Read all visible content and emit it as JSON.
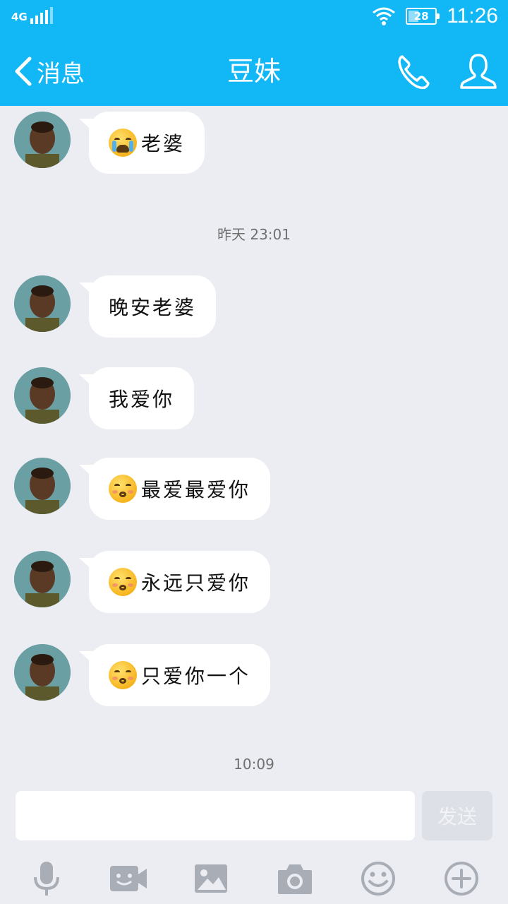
{
  "status_bar": {
    "network": "4G",
    "battery": "28",
    "time": "11:26"
  },
  "header": {
    "back_label": "消息",
    "title": "豆妹",
    "icons": [
      "phone-icon",
      "contact-icon"
    ]
  },
  "messages": [
    {
      "emoji": "crying-emoji",
      "text": "老婆"
    },
    {
      "emoji": null,
      "text": "晚安老婆"
    },
    {
      "emoji": null,
      "text": "我爱你"
    },
    {
      "emoji": "kissing-emoji",
      "text": "最爱最爱你"
    },
    {
      "emoji": "kissing-emoji",
      "text": "永远只爱你"
    },
    {
      "emoji": "kissing-emoji",
      "text": "只爱你一个"
    }
  ],
  "timestamps": {
    "first": "昨天 23:01",
    "second": "10:09"
  },
  "composer": {
    "input_value": "",
    "send_label": "发送",
    "toolbar_icons": [
      "microphone-icon",
      "video-call-icon",
      "image-icon",
      "camera-icon",
      "emoji-icon",
      "plus-icon"
    ]
  },
  "colors": {
    "header_bg": "#12b7f5",
    "chat_bg": "#ebedf3",
    "bubble_bg": "#ffffff",
    "icon_gray": "#a9adb6"
  }
}
